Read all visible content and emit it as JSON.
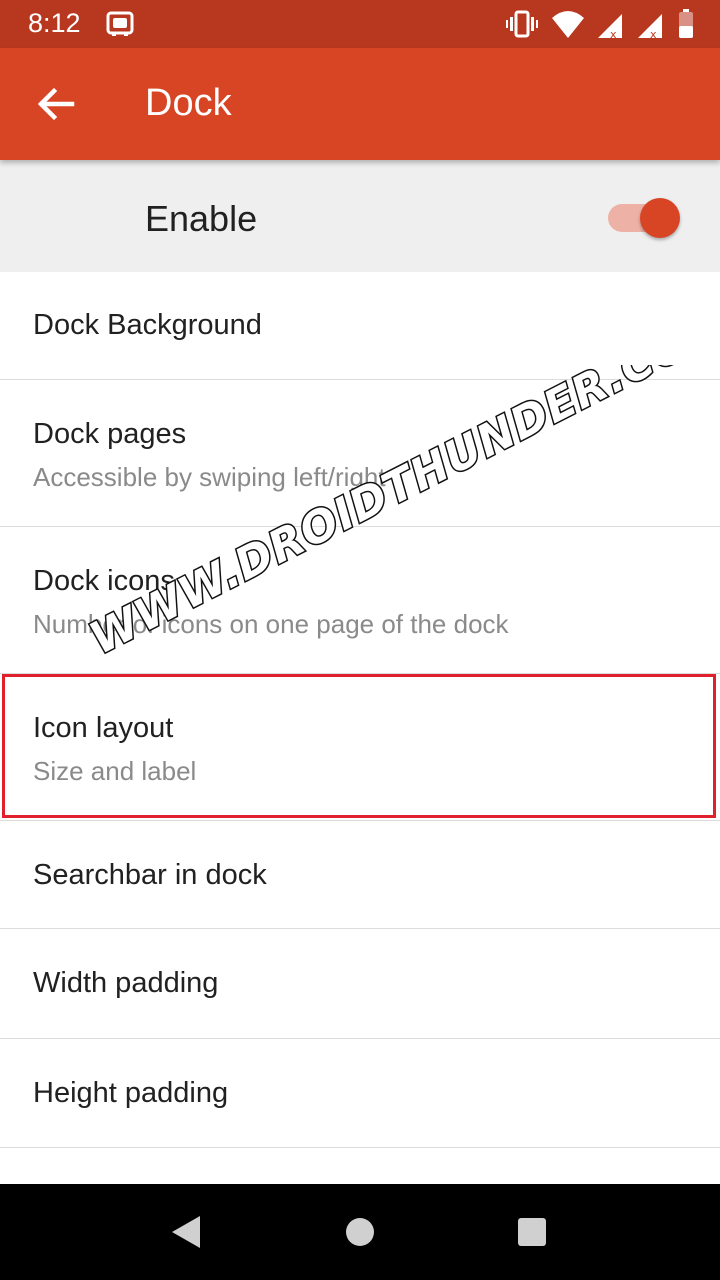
{
  "status_bar": {
    "time": "8:12",
    "bg_color": "#b8371f"
  },
  "app_bar": {
    "title": "Dock",
    "back_icon": "arrow-back-icon",
    "color": "#d84525"
  },
  "enable_row": {
    "label": "Enable",
    "toggle_on": true
  },
  "list": {
    "items": [
      {
        "title": "Dock Background",
        "subtitle": ""
      },
      {
        "title": "Dock pages",
        "subtitle": "Accessible by swiping left/right"
      },
      {
        "title": "Dock icons",
        "subtitle": "Number of icons on one page of the dock"
      },
      {
        "title": "Icon layout",
        "subtitle": "Size and label"
      },
      {
        "title": "Searchbar in dock",
        "subtitle": ""
      },
      {
        "title": "Width padding",
        "subtitle": ""
      },
      {
        "title": "Height padding",
        "subtitle": ""
      }
    ]
  },
  "watermark": {
    "text": "WWW.DROIDTHUNDER.COM"
  },
  "nav_bar": {
    "back_icon": "nav-back-icon",
    "home_icon": "nav-home-icon",
    "recents_icon": "nav-recents-icon"
  }
}
